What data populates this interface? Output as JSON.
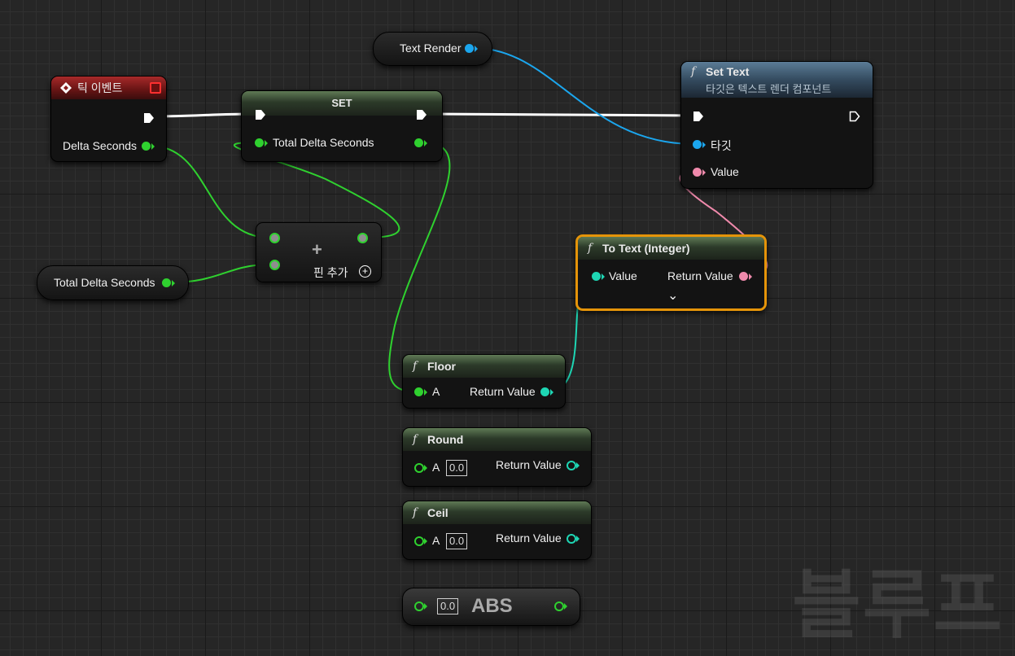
{
  "nodes": {
    "text_render": {
      "label": "Text Render"
    },
    "tick_event": {
      "title": "틱 이벤트",
      "delta_label": "Delta Seconds"
    },
    "set_node": {
      "title": "SET",
      "var_label": "Total Delta Seconds"
    },
    "set_text": {
      "title": "Set Text",
      "subtitle": "타깃은 텍스트 렌더 컴포넌트",
      "target_label": "타깃",
      "value_label": "Value"
    },
    "add_node": {
      "plus": "+",
      "add_pin_label": "핀 추가"
    },
    "total_delta_getter": {
      "label": "Total Delta Seconds"
    },
    "to_text": {
      "title": "To Text (Integer)",
      "input_label": "Value",
      "output_label": "Return Value",
      "expand": "⌄"
    },
    "floor": {
      "title": "Floor",
      "input_label": "A",
      "output_label": "Return Value"
    },
    "round": {
      "title": "Round",
      "input_label": "A",
      "input_value": "0.0",
      "output_label": "Return Value"
    },
    "ceil": {
      "title": "Ceil",
      "input_label": "A",
      "input_value": "0.0",
      "output_label": "Return Value"
    },
    "abs": {
      "title": "ABS",
      "input_value": "0.0"
    }
  },
  "function_glyph": "f",
  "watermark": "블루프",
  "colors": {
    "float_pin": "#2fd12f",
    "int_pin": "#1ed6b4",
    "object_pin": "#1ba6ee",
    "text_pin": "#f08aac",
    "exec_wire": "#ffffff",
    "selection": "#e59409"
  }
}
